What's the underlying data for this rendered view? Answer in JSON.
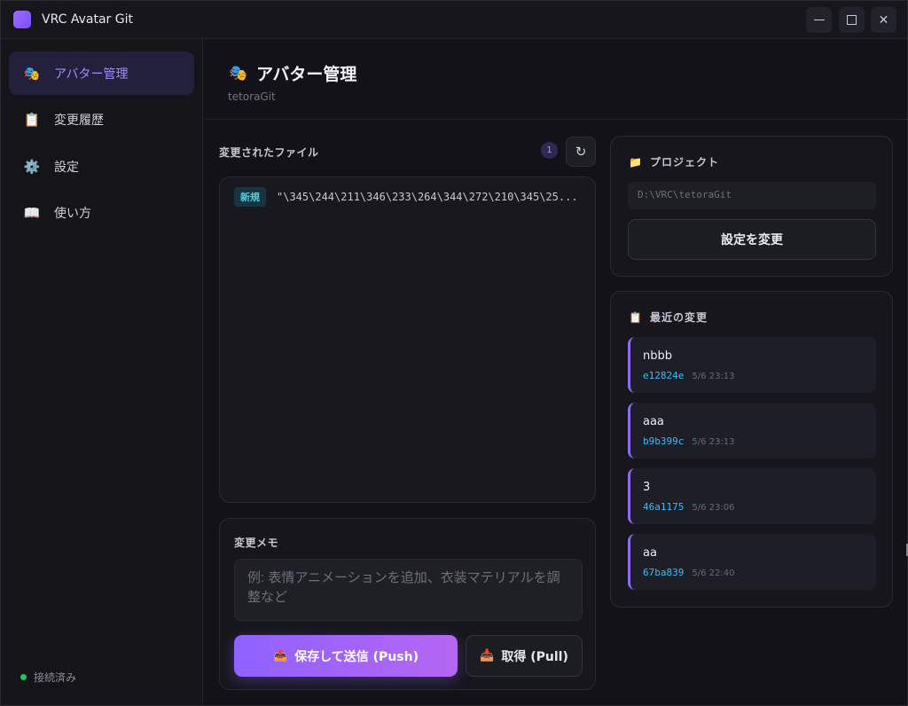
{
  "window": {
    "title": "VRC Avatar Git",
    "controls": {
      "minimize": "—",
      "maximize": "☐",
      "close": "✕"
    }
  },
  "sidebar": {
    "items": [
      {
        "label": "アバター管理",
        "icon": "🎭",
        "active": true
      },
      {
        "label": "変更履歴",
        "icon": "📋",
        "active": false
      },
      {
        "label": "設定",
        "icon": "⚙️",
        "active": false
      },
      {
        "label": "使い方",
        "icon": "📖",
        "active": false
      }
    ],
    "status": "接続済み"
  },
  "header": {
    "icon": "🎭",
    "title": "アバター管理",
    "subtitle": "tetoraGit"
  },
  "changes": {
    "label": "変更されたファイル",
    "count": "1",
    "refresh_icon": "↻",
    "files": [
      {
        "badge": "新規",
        "path": "\"\\345\\244\\211\\346\\233\\264\\344\\272\\210\\345\\25..."
      }
    ]
  },
  "memo": {
    "label": "変更メモ",
    "placeholder": "例: 表情アニメーションを追加、衣装マテリアルを調整など",
    "value": ""
  },
  "actions": {
    "push_icon": "📤",
    "push_label": "保存して送信 (Push)",
    "pull_icon": "📥",
    "pull_label": "取得 (Pull)"
  },
  "project": {
    "icon": "📁",
    "label": "プロジェクト",
    "path": "D:\\VRC\\tetoraGit",
    "settings_button": "設定を変更"
  },
  "recent": {
    "icon": "📋",
    "label": "最近の変更",
    "commits": [
      {
        "message": "nbbb",
        "hash": "e12824e",
        "time": "5/6 23:13"
      },
      {
        "message": "aaa",
        "hash": "b9b399c",
        "time": "5/6 23:13"
      },
      {
        "message": "3",
        "hash": "46a1175",
        "time": "5/6 23:06"
      },
      {
        "message": "aa",
        "hash": "67ba839",
        "time": "5/6 22:40"
      }
    ]
  },
  "colors": {
    "accent": "#8f62ff",
    "accent_light": "#a48bff",
    "hash": "#38bdf8",
    "status_ok": "#22c55e",
    "new_badge": "#4fd1e0"
  }
}
